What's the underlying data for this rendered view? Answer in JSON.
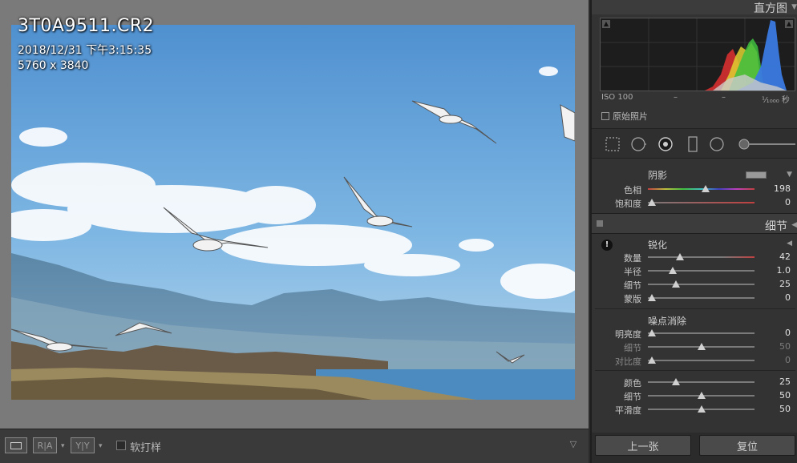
{
  "photo": {
    "filename": "3T0A9511.CR2",
    "datetime": "2018/12/31 下午3:15:35",
    "dimensions": "5760 x 3840"
  },
  "toolbar": {
    "view_label": "",
    "ra_label": "R|A",
    "yy_label": "Y|Y",
    "soft_proof_label": "软打样"
  },
  "histogram": {
    "title": "直方图",
    "iso": "ISO 100",
    "focal": "–",
    "aperture": "–",
    "shutter": "¹⁄₁₀₀₀ 秒",
    "original_label": "原始照片"
  },
  "shadows": {
    "title": "阴影",
    "rows": [
      {
        "label": "色相",
        "value": "198",
        "pos": 0.54
      },
      {
        "label": "饱和度",
        "value": "0",
        "pos": 0.04
      }
    ]
  },
  "detail": {
    "title": "细节",
    "sharpen": {
      "title": "锐化",
      "rows": [
        {
          "label": "数量",
          "value": "42",
          "pos": 0.3
        },
        {
          "label": "半径",
          "value": "1.0",
          "pos": 0.23
        },
        {
          "label": "细节",
          "value": "25",
          "pos": 0.26
        },
        {
          "label": "蒙版",
          "value": "0",
          "pos": 0.04
        }
      ]
    },
    "noise": {
      "title": "噪点消除",
      "rows": [
        {
          "label": "明亮度",
          "value": "0",
          "pos": 0.04
        },
        {
          "label": "细节",
          "value": "50",
          "pos": 0.5
        },
        {
          "label": "对比度",
          "value": "0",
          "pos": 0.04
        }
      ]
    },
    "color": {
      "rows": [
        {
          "label": "颜色",
          "value": "25",
          "pos": 0.26
        },
        {
          "label": "细节",
          "value": "50",
          "pos": 0.5
        },
        {
          "label": "平滑度",
          "value": "50",
          "pos": 0.5
        }
      ]
    }
  },
  "buttons": {
    "prev": "上一张",
    "reset": "复位"
  },
  "colors": {
    "panel_bg": "#333333",
    "canvas_bg": "#7a7a7a",
    "sky": "#6aa6d8"
  }
}
